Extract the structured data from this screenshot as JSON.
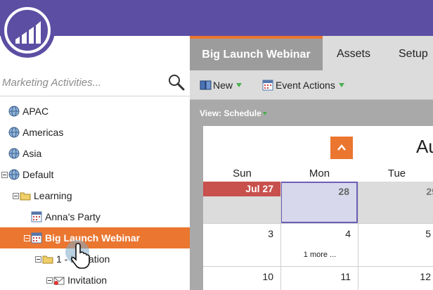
{
  "search": {
    "placeholder": "Marketing Activities..."
  },
  "tree": [
    {
      "label": "APAC",
      "icon": "globe-icon",
      "expander": false,
      "indent": 0,
      "selected": false
    },
    {
      "label": "Americas",
      "icon": "globe-icon",
      "expander": false,
      "indent": 0,
      "selected": false
    },
    {
      "label": "Asia",
      "icon": "globe-icon",
      "expander": false,
      "indent": 0,
      "selected": false
    },
    {
      "label": "Default",
      "icon": "globe-icon",
      "expander": true,
      "indent": 0,
      "selected": false
    },
    {
      "label": "Learning",
      "icon": "folder-icon",
      "expander": true,
      "indent": 1,
      "selected": false
    },
    {
      "label": "Anna's Party",
      "icon": "calendar-icon",
      "expander": false,
      "indent": 2,
      "selected": false
    },
    {
      "label": "Big Launch Webinar",
      "icon": "calendar-icon",
      "expander": true,
      "indent": 2,
      "selected": true
    },
    {
      "label": "1 - Invitation",
      "icon": "folder-icon",
      "expander": true,
      "indent": 3,
      "selected": false
    },
    {
      "label": "Invitation",
      "icon": "email-icon",
      "expander": true,
      "indent": 4,
      "selected": false
    }
  ],
  "tabs": [
    "Big Launch Webinar",
    "Assets",
    "Setup"
  ],
  "toolbar": {
    "new_label": "New",
    "event_actions_label": "Event Actions"
  },
  "view": {
    "label": "View: Schedule"
  },
  "calendar": {
    "month_fragment": "Au",
    "days_of_week": [
      "Sun",
      "Mon",
      "Tue"
    ],
    "weeks": [
      [
        "Jul 27",
        "28",
        "29"
      ],
      [
        "3",
        "4",
        "5"
      ],
      [
        "10",
        "11",
        "12"
      ]
    ],
    "more_link": "1 more ..."
  },
  "colors": {
    "brand": "#5c4ea3",
    "accent": "#ea7630",
    "today": "#c8504d"
  }
}
